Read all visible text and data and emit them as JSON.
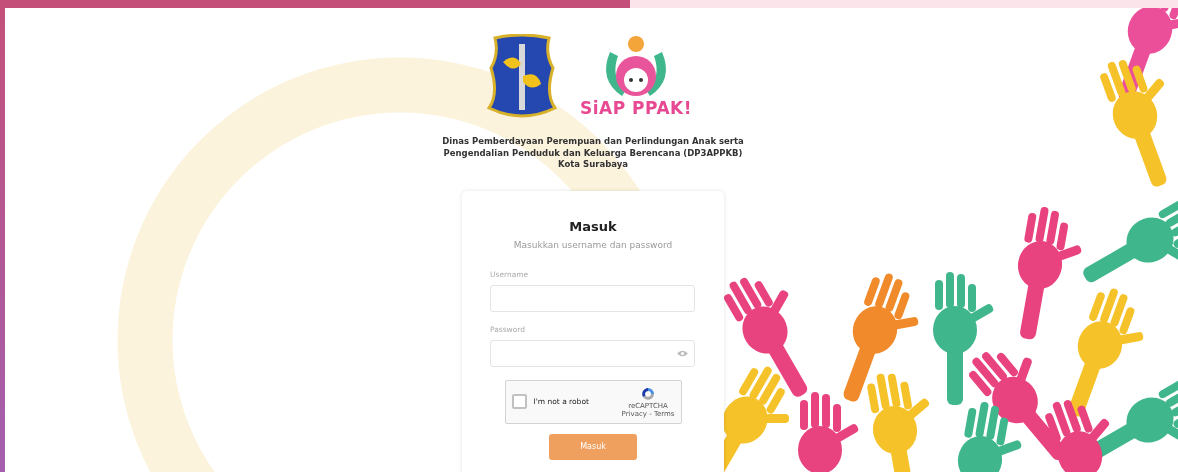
{
  "logos": {
    "brand": "SiAP PPAK!"
  },
  "agency": {
    "lines": [
      "Dinas Pemberdayaan Perempuan dan Perlindungan Anak serta",
      "Pengendalian Penduduk dan Keluarga Berencana (DP3APPKB)",
      "Kota Surabaya"
    ]
  },
  "login": {
    "title": "Masuk",
    "subtitle": "Masukkan username dan password",
    "fields": [
      {
        "label": "Username",
        "kind": "text"
      },
      {
        "label": "Password",
        "kind": "password"
      }
    ],
    "captcha": {
      "label": "I'm not a robot",
      "checked": false,
      "brand": "reCAPTCHA",
      "links": "Privacy - Terms"
    },
    "submit": "Masuk"
  }
}
